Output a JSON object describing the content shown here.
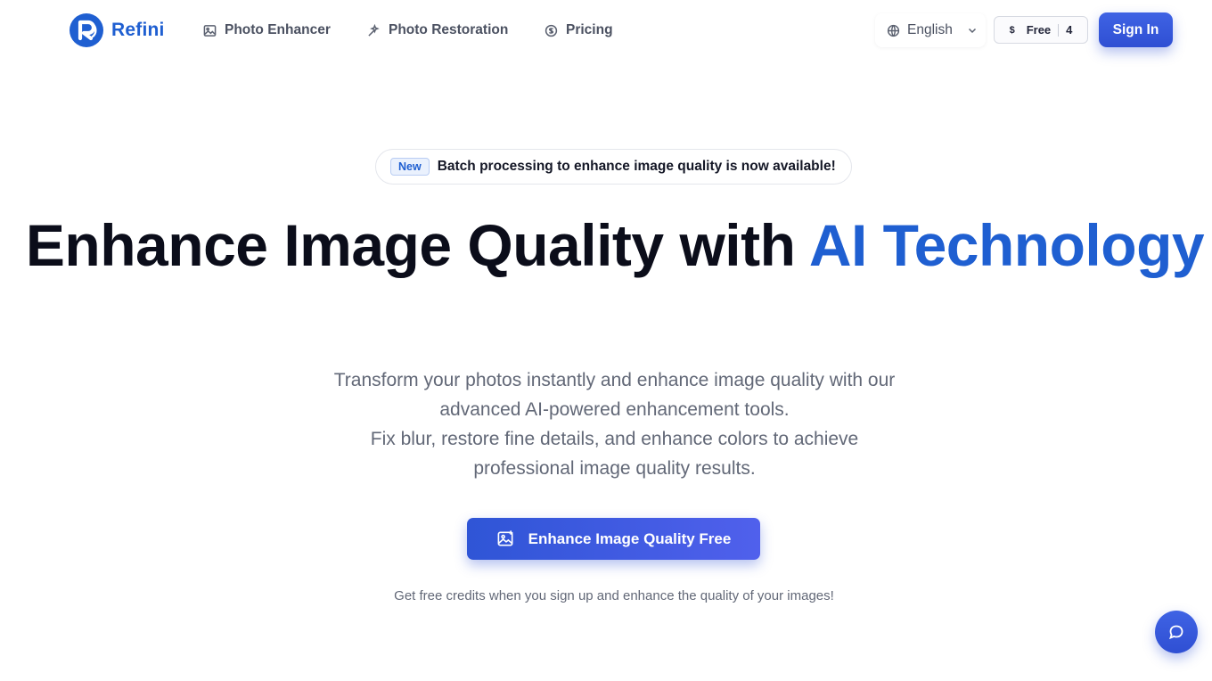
{
  "brand": {
    "name": "Refini",
    "color": "#1f5fd1"
  },
  "nav": {
    "items": [
      {
        "label": "Photo Enhancer",
        "icon": "image-icon"
      },
      {
        "label": "Photo Restoration",
        "icon": "wand-icon"
      },
      {
        "label": "Pricing",
        "icon": "coin-icon"
      }
    ],
    "language": "English",
    "credits": {
      "symbol": "$",
      "plan": "Free",
      "count": "4"
    },
    "sign_in": "Sign In"
  },
  "hero": {
    "announcement_badge": "New",
    "announcement_icon": "",
    "announcement_text": "Batch processing to enhance image quality is now available!",
    "title_main": "Enhance Image Quality with ",
    "title_accent": "AI Technology",
    "subtitle_lines": [
      "Transform your photos instantly and enhance image quality with our",
      "advanced AI-powered enhancement tools.",
      "Fix blur, restore fine details, and enhance colors to achieve",
      "professional image quality results."
    ],
    "cta_label": "Enhance Image Quality Free",
    "note_icon": "",
    "note_text": "Get free credits when you sign up and enhance the quality of your images!"
  },
  "colors": {
    "accent": "#1f5fd1",
    "button": "#2f4fd3",
    "text": "#0b0d1a",
    "muted": "#626877"
  }
}
